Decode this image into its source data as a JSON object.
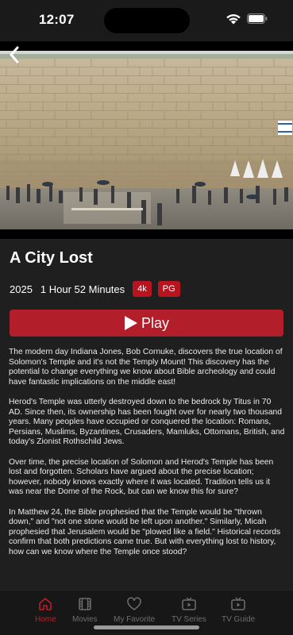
{
  "status_bar": {
    "time": "12:07"
  },
  "movie": {
    "title": "A City Lost",
    "year": "2025",
    "duration": "1 Hour 52 Minutes",
    "badges": [
      "4k",
      "PG"
    ],
    "play_label": "Play",
    "description": [
      "The modern day Indiana Jones, Bob Cornuke, discovers the true location of Solomon's Temple and it's not the Temply Mount! This discovery has the potential to change everything we know about Bible archeology and could have fantastic implications on the middle east!",
      "Herod's Temple was utterly destroyed down to the bedrock by Titus in 70 AD. Since then, its ownership has been fought over for nearly two thousand years. Many peoples have occupied or conquered the location: Romans, Persians, Muslims, Byzantines, Crusaders, Mamluks, Ottomans, British, and today's Zionist Rothschild Jews.",
      "Over time, the precise location of Solomon and Herod's Temple has been lost and forgotten. Scholars have argued about the precise location; however, nobody knows exactly where it was located. Tradition tells us it was near the Dome of the Rock, but can we know this for sure?",
      "In Matthew 24, the Bible prophesied that the Temple would be \"thrown down,\" and \"not one stone would be left upon another.\" Similarly, Micah prophesied that Jerusalem would be \"plowed like a field.\" Historical records confirm that both predictions came true. But with everything lost to history, how can we know where the Temple once stood?"
    ]
  },
  "tabs": [
    {
      "label": "Home",
      "icon": "home-icon",
      "active": true
    },
    {
      "label": "Movies",
      "icon": "film-icon",
      "active": false
    },
    {
      "label": "My Favorite",
      "icon": "heart-icon",
      "active": false
    },
    {
      "label": "TV Series",
      "icon": "tv-series-icon",
      "active": false
    },
    {
      "label": "TV Guide",
      "icon": "tv-guide-icon",
      "active": false
    }
  ],
  "colors": {
    "accent": "#c21b26",
    "play_button": "#b21f2a",
    "badge": "#b8141f",
    "background": "#1f1f1f"
  }
}
